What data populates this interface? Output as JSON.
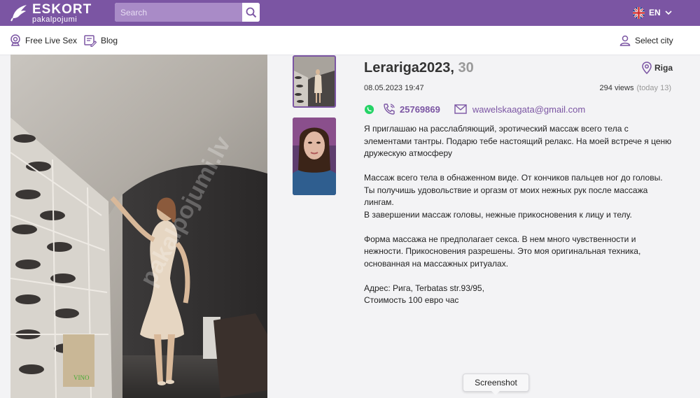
{
  "header": {
    "logo_brand": "ESKORT",
    "logo_sub": "pakalpojumi",
    "search_placeholder": "Search",
    "language": "EN"
  },
  "nav": {
    "free_live_sex": "Free Live Sex",
    "blog": "Blog",
    "select_city": "Select city"
  },
  "photo": {
    "watermark": "pakalpojumi.lv"
  },
  "profile": {
    "name": "Lerariga2023,",
    "age": "30",
    "city": "Riga",
    "date": "08.05.2023 19:47",
    "views": "294 views",
    "views_today": "(today 13)",
    "phone": "25769869",
    "email": "wawelskaagata@gmail.com",
    "description": [
      "Я приглашаю на расслабляющий, эротический массаж всего тела с элементами тантры. Подарю тебе настоящий релакс. На моей встрече я ценю дружескую атмосферу",
      "Массаж всего тела в обнаженном виде. От кончиков пальцев ног до головы. Ты получишь удовольствие и оргазм от моих нежных рук после массажа лингам.",
      "В завершении массаж головы, нежные прикосновения к лицу и телу.",
      "Форма массажа не предполагает секса. В нем много чувственности и нежности. Прикосновения разрешены. Это моя оригинальная техника, основанная на массажных ритуалах.",
      "Адрес: Рига, Terbatas str.93/95,",
      "Стоимость 100 евро час"
    ]
  },
  "tooltip": "Screenshot",
  "colors": {
    "brand": "#7b55a3",
    "whatsapp": "#25d366"
  }
}
